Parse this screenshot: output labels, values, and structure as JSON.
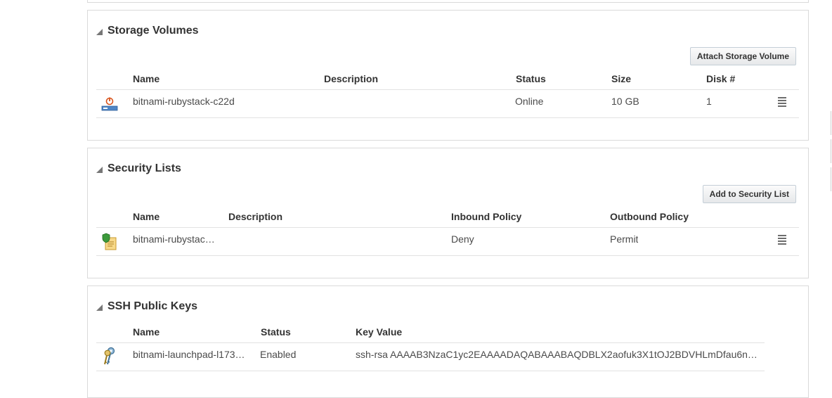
{
  "storage": {
    "title": "Storage Volumes",
    "button": "Attach Storage Volume",
    "columns": {
      "name": "Name",
      "description": "Description",
      "status": "Status",
      "size": "Size",
      "disk": "Disk #"
    },
    "row": {
      "icon": "storage-volume-power-icon",
      "name": "bitnami-rubystack-c22d",
      "description": "",
      "status": "Online",
      "size": "10 GB",
      "disk": "1"
    }
  },
  "security": {
    "title": "Security Lists",
    "button": "Add to Security List",
    "columns": {
      "name": "Name",
      "description": "Description",
      "inbound": "Inbound Policy",
      "outbound": "Outbound Policy"
    },
    "row": {
      "icon": "security-list-shield-icon",
      "name": "bitnami-rubystac…",
      "description": "",
      "inbound": "Deny",
      "outbound": "Permit"
    }
  },
  "ssh": {
    "title": "SSH Public Keys",
    "columns": {
      "name": "Name",
      "status": "Status",
      "key": "Key Value"
    },
    "row": {
      "icon": "keys-icon",
      "name": "bitnami-launchpad-l173…",
      "status": "Enabled",
      "key": "ssh-rsa AAAAB3NzaC1yc2EAAAADAQABAAABAQDBLX2aofuk3X1tOJ2BDVHLmDfau6n…"
    }
  }
}
